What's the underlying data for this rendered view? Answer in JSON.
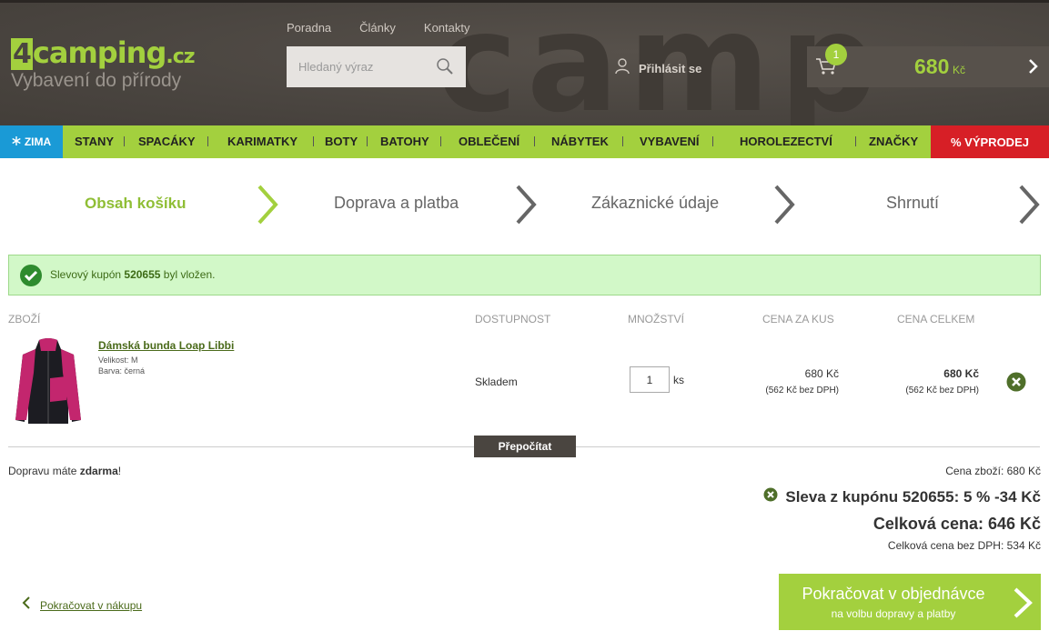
{
  "header": {
    "logo_main": "camping",
    "logo_num": "4",
    "logo_tld": ".cz",
    "tagline": "Vybavení do přírody",
    "top_links": [
      "Poradna",
      "Články",
      "Kontakty"
    ],
    "search_placeholder": "Hledaný výraz",
    "login_label": "Přihlásit se",
    "cart_count": "1",
    "cart_price": "680",
    "cart_currency": "Kč"
  },
  "nav": {
    "zima": "ZIMA",
    "items": [
      "STANY",
      "SPACÁKY",
      "KARIMATKY",
      "BOTY",
      "BATOHY",
      "OBLEČENÍ",
      "NÁBYTEK",
      "VYBAVENÍ",
      "HOROLEZECTVÍ",
      "ZNAČKY"
    ],
    "sale": "% VÝPRODEJ"
  },
  "steps": [
    "Obsah košíku",
    "Doprava a platba",
    "Zákaznické údaje",
    "Shrnutí"
  ],
  "success": {
    "prefix": "Slevový kupón",
    "code": "520655",
    "suffix": "byl vložen."
  },
  "table": {
    "headers": [
      "ZBOŽÍ",
      "DOSTUPNOST",
      "MNOŽSTVÍ",
      "CENA ZA KUS",
      "CENA CELKEM"
    ],
    "item": {
      "name": "Dámská bunda Loap Libbi",
      "size": "Velikost: M",
      "color": "Barva: černá",
      "availability": "Skladem",
      "quantity": "1",
      "unit": "ks",
      "unit_price": "680 Kč",
      "unit_price_net": "(562 Kč bez DPH)",
      "total_price": "680 Kč",
      "total_price_net": "(562 Kč bez DPH)"
    },
    "recalc": "Přepočítat"
  },
  "summary": {
    "shipping_prefix": "Dopravu máte",
    "shipping_bold": "zdarma",
    "shipping_suffix": "!",
    "goods_price": "Cena zboží: 680 Kč",
    "discount": "Sleva z kupónu 520655: 5 % -34 Kč",
    "total": "Celková cena: 646 Kč",
    "total_net": "Celková cena bez DPH: 534 Kč"
  },
  "footer": {
    "back": "Pokračovat v nákupu",
    "continue_main": "Pokračovat v objednávce",
    "continue_sub": "na volbu dopravy a platby"
  },
  "colors": {
    "brand_green": "#a3d03e",
    "header_bg": "#4a4540",
    "sale_red": "#d71f26",
    "zima_blue": "#1a9ad6"
  }
}
